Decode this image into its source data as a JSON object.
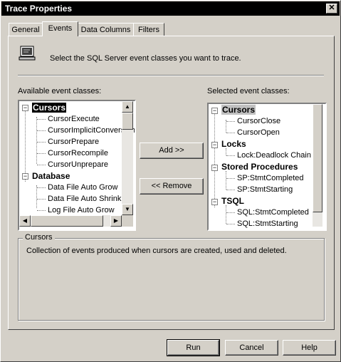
{
  "window": {
    "title": "Trace Properties",
    "close_glyph": "✕"
  },
  "tabs": [
    {
      "label": "General",
      "active": false
    },
    {
      "label": "Events",
      "active": true
    },
    {
      "label": "Data Columns",
      "active": false
    },
    {
      "label": "Filters",
      "active": false
    }
  ],
  "instruction": "Select the SQL Server event classes you want to trace.",
  "available": {
    "label": "Available event classes:",
    "items": [
      {
        "text": "Cursors",
        "category": true,
        "selected": true
      },
      {
        "text": "CursorExecute"
      },
      {
        "text": "CursorImplicitConversion"
      },
      {
        "text": "CursorPrepare"
      },
      {
        "text": "CursorRecompile"
      },
      {
        "text": "CursorUnprepare"
      },
      {
        "text": "Database",
        "category": true
      },
      {
        "text": "Data File Auto Grow"
      },
      {
        "text": "Data File Auto Shrink"
      },
      {
        "text": "Log File Auto Grow"
      }
    ]
  },
  "selected": {
    "label": "Selected event classes:",
    "items": [
      {
        "text": "Cursors",
        "category": true,
        "highlight": true
      },
      {
        "text": "CursorClose"
      },
      {
        "text": "CursorOpen"
      },
      {
        "text": "Locks",
        "category": true
      },
      {
        "text": "Lock:Deadlock Chain"
      },
      {
        "text": "Stored Procedures",
        "category": true
      },
      {
        "text": "SP:StmtCompleted"
      },
      {
        "text": "SP:StmtStarting"
      },
      {
        "text": "TSQL",
        "category": true
      },
      {
        "text": "SQL:StmtCompleted"
      },
      {
        "text": "SQL:StmtStarting"
      }
    ]
  },
  "buttons": {
    "add": "Add >>",
    "remove": "<< Remove",
    "run": "Run",
    "cancel": "Cancel",
    "help": "Help"
  },
  "description": {
    "title": "Cursors",
    "text": "Collection of events produced when cursors are created, used and deleted."
  }
}
